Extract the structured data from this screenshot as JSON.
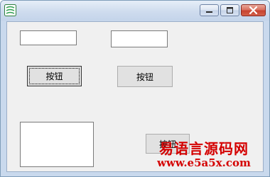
{
  "window": {
    "app_icon": "app-icon",
    "controls": {
      "minimize_icon": "minimize-icon",
      "maximize_icon": "maximize-icon",
      "close_icon": "close-icon"
    }
  },
  "form": {
    "textbox1_value": "",
    "textbox2_value": "",
    "button1_label": "按钮",
    "button2_label": "按钮",
    "button3_label": "按钮"
  },
  "watermark": {
    "line1": "易语言源码网",
    "line2": "www.e5a5x.com",
    "color": "#d40000"
  }
}
